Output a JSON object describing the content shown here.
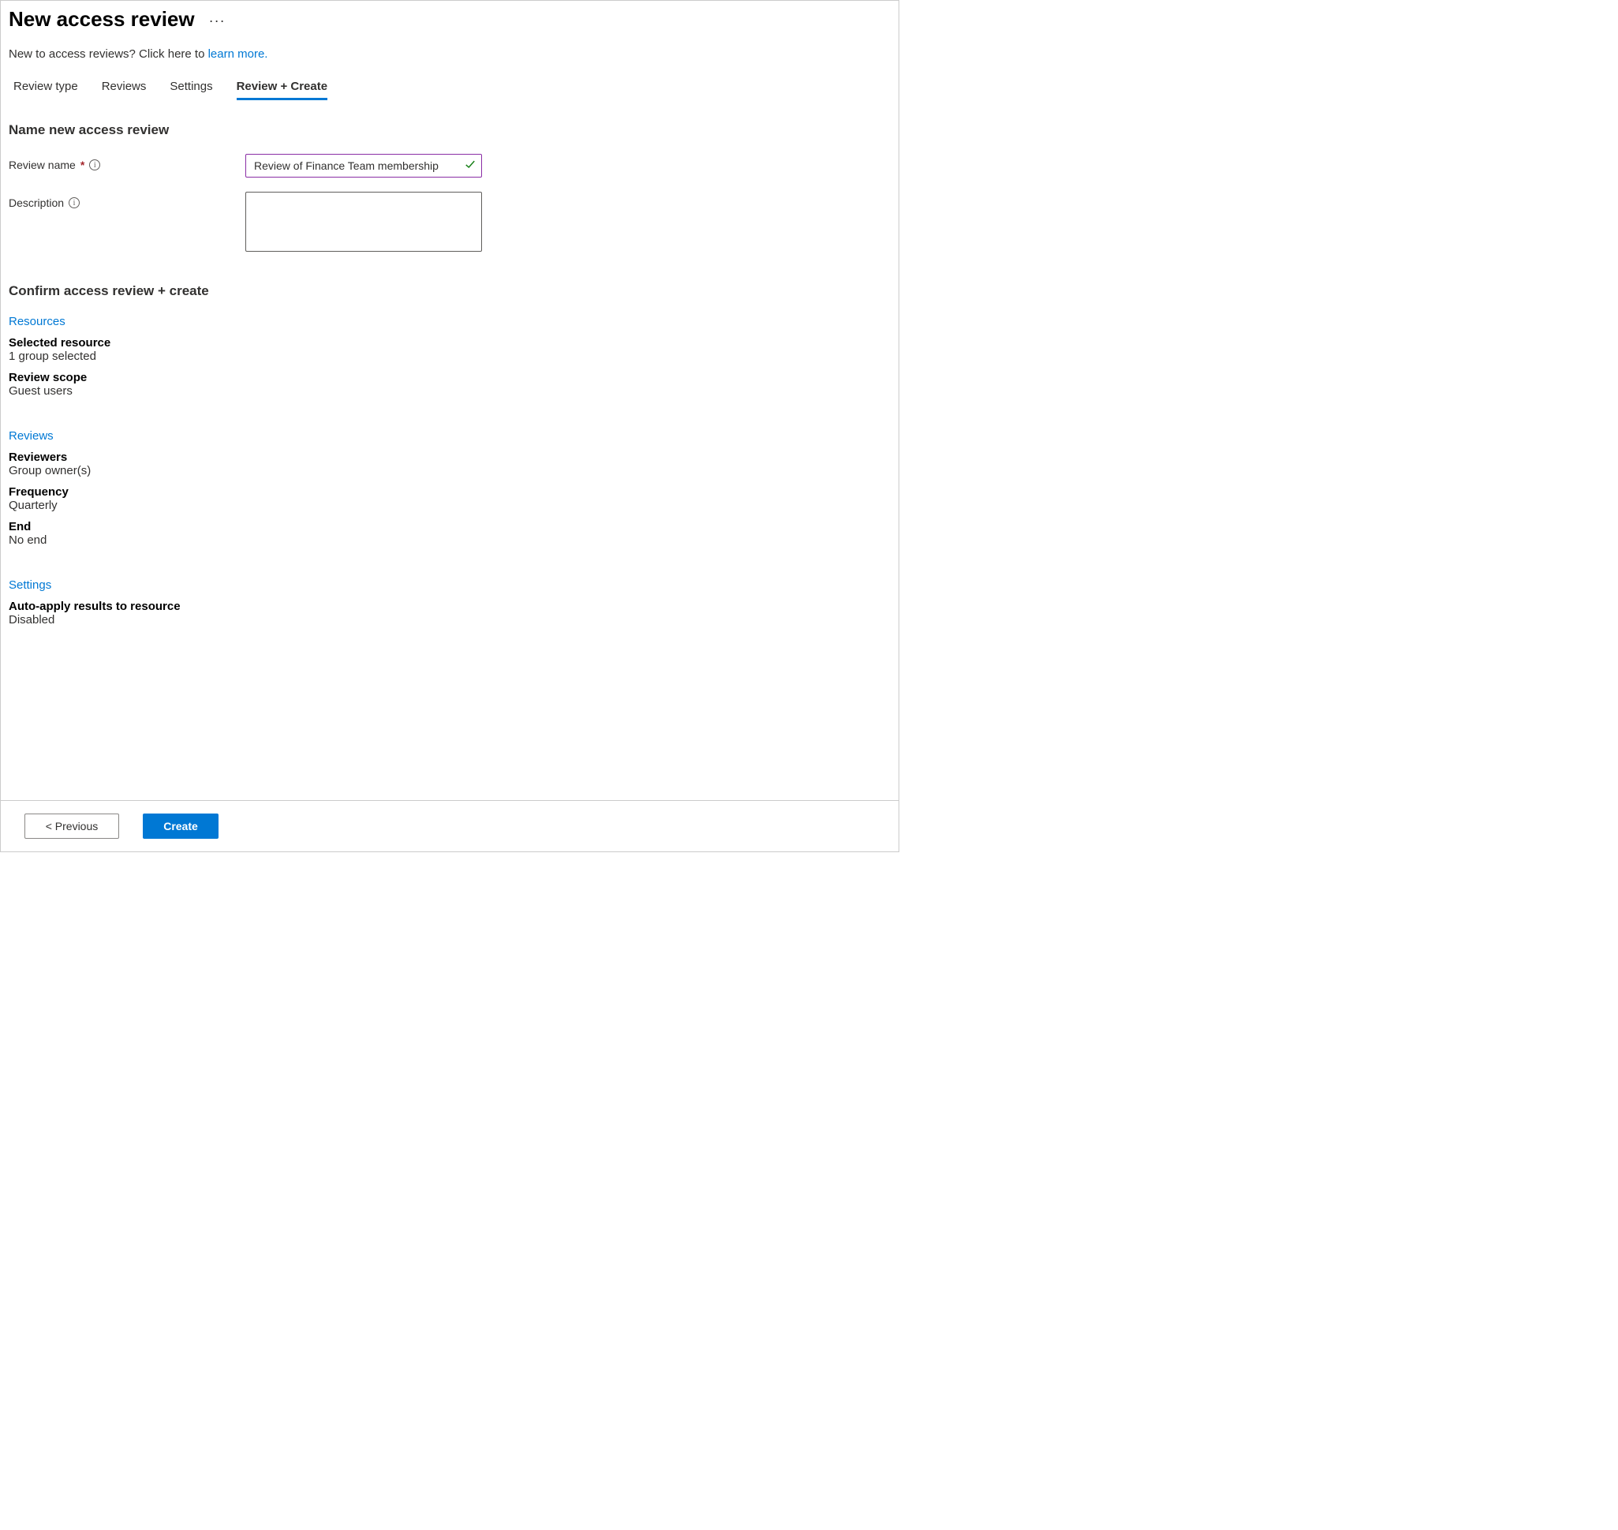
{
  "header": {
    "title": "New access review"
  },
  "intro": {
    "prefix": "New to access reviews? Click here to ",
    "link_text": "learn more.",
    "link_suffix": ""
  },
  "tabs": [
    {
      "label": "Review type",
      "active": false
    },
    {
      "label": "Reviews",
      "active": false
    },
    {
      "label": "Settings",
      "active": false
    },
    {
      "label": "Review + Create",
      "active": true
    }
  ],
  "name_section": {
    "heading": "Name new access review",
    "review_name_label": "Review name",
    "review_name_value": "Review of Finance Team membership",
    "description_label": "Description",
    "description_value": ""
  },
  "confirm_section": {
    "heading": "Confirm access review + create",
    "groups": [
      {
        "link": "Resources",
        "items": [
          {
            "label": "Selected resource",
            "value": "1 group selected"
          },
          {
            "label": "Review scope",
            "value": "Guest users"
          }
        ]
      },
      {
        "link": "Reviews",
        "items": [
          {
            "label": "Reviewers",
            "value": "Group owner(s)"
          },
          {
            "label": "Frequency",
            "value": "Quarterly"
          },
          {
            "label": "End",
            "value": "No end"
          }
        ]
      },
      {
        "link": "Settings",
        "items": [
          {
            "label": "Auto-apply results to resource",
            "value": "Disabled"
          }
        ]
      }
    ]
  },
  "footer": {
    "previous_label": "< Previous",
    "create_label": "Create"
  }
}
